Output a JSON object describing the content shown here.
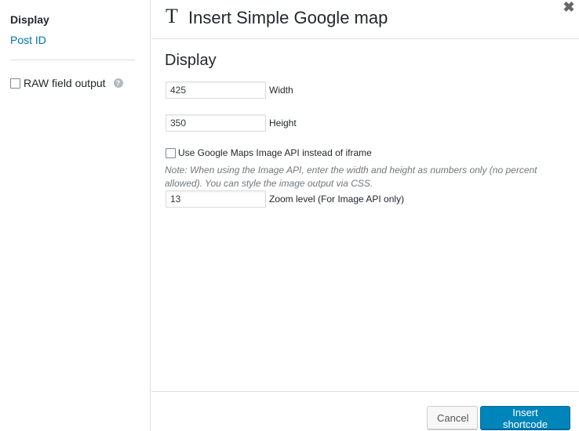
{
  "sidebar": {
    "heading": "Display",
    "link": "Post ID",
    "option_label": "RAW field output",
    "help_glyph": "?"
  },
  "dialog": {
    "title_glyph": "T",
    "title": "Insert Simple Google map",
    "close_glyph": "✖"
  },
  "display": {
    "section_title": "Display",
    "width_value": "425",
    "width_label": "Width",
    "height_value": "350",
    "height_label": "Height",
    "image_api_label": "Use Google Maps Image API instead of iframe",
    "note": "Note: When using the Image API, enter the width and height as numbers only (no percent allowed). You can style the image output via CSS.",
    "zoom_value": "13",
    "zoom_label": "Zoom level (For Image API only)"
  },
  "footer": {
    "cancel_label": "Cancel",
    "insert_label": "Insert shortcode"
  },
  "colors": {
    "link": "#0073aa",
    "primary_button": "#0085ba"
  }
}
